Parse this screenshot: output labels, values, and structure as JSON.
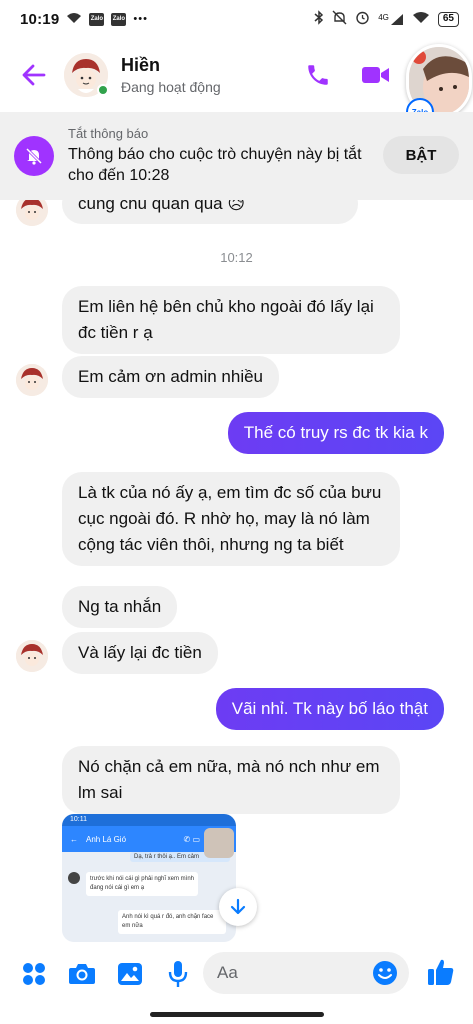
{
  "status_bar": {
    "time": "10:19",
    "app_icons": [
      "Zalo",
      "Zalo"
    ],
    "more": "•••",
    "network": "4G",
    "battery": "65"
  },
  "header": {
    "name": "Hiền",
    "status": "Đang hoạt động"
  },
  "floating_bubble": {
    "badge": "Zalo"
  },
  "notification": {
    "title": "Tắt thông báo",
    "body": "Thông báo cho cuộc trò chuyện này bị tắt cho đến 10:28",
    "button": "BẬT"
  },
  "conversation": {
    "partial_message": "cũng chủ quán quá 😥",
    "timestamp": "10:12",
    "messages": [
      {
        "text": "Em liên hệ bên chủ kho ngoài đó lấy lại đc tiền r ạ",
        "from": "them"
      },
      {
        "text": "Em cảm ơn admin nhiều",
        "from": "them"
      },
      {
        "text": "Thế có truy rs đc tk kia k",
        "from": "me"
      },
      {
        "text": "Là tk của nó ấy ạ, em tìm đc số của bưu cục ngoài đó. R nhờ họ, may là nó làm cộng tác viên thôi, nhưng ng ta biết",
        "from": "them"
      },
      {
        "text": "Ng ta nhắn",
        "from": "them"
      },
      {
        "text": "Và lấy lại đc tiền",
        "from": "them"
      },
      {
        "text": "Vãi nhỉ. Tk này bố láo thật",
        "from": "me"
      },
      {
        "text": "Nó chặn cả em nữa, mà nó nch như em lm sai",
        "from": "them"
      }
    ],
    "screenshot_preview": {
      "time": "10:11",
      "contact": "Anh Lá Gió",
      "lines": [
        "Dạ, trả r thôi ạ.. Em cảm",
        "trước khi nói cái gì phải nghĩ xem mình đang nói cái gì em ạ",
        "Anh nói kì quá r đó, anh chặn face em nữa"
      ]
    }
  },
  "composer": {
    "placeholder": "Aa"
  },
  "colors": {
    "accent": "#a033ff",
    "outgoing_bubble": "#5b46f5",
    "incoming_bubble": "#f0f0f0",
    "online": "#31a24c",
    "like_icon": "#0a7cff"
  }
}
